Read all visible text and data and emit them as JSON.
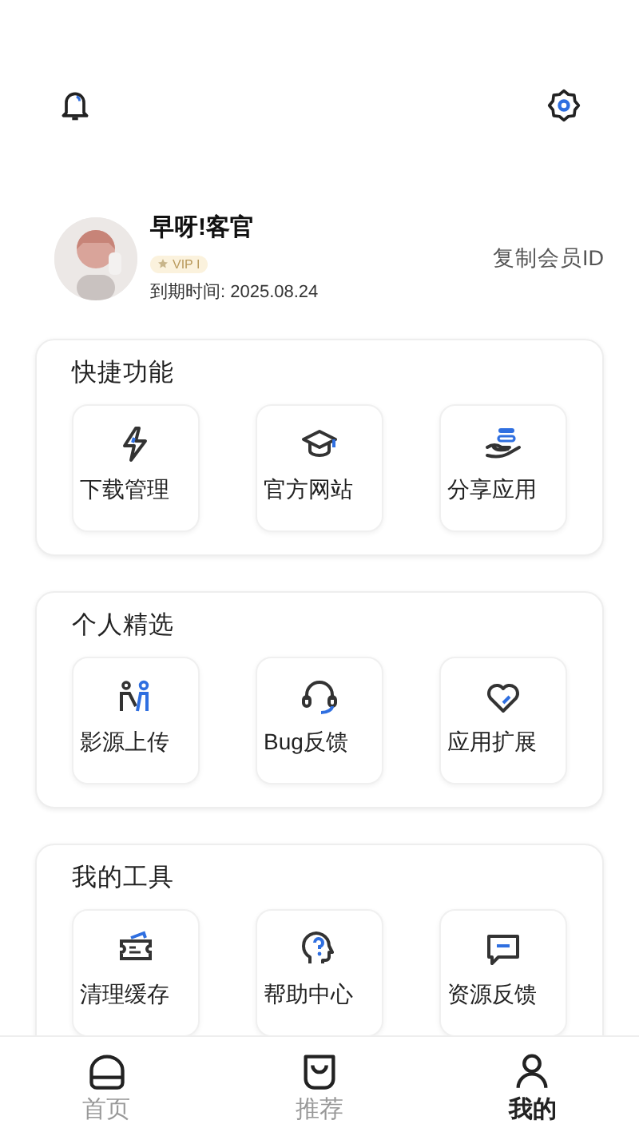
{
  "profile": {
    "name": "早呀!客官",
    "vip": "VIP I",
    "expiry": "到期时间: 2025.08.24",
    "copy_id": "复制会员ID"
  },
  "sections": [
    {
      "title": "快捷功能",
      "items": [
        {
          "label": "下载管理"
        },
        {
          "label": "官方网站"
        },
        {
          "label": "分享应用"
        }
      ]
    },
    {
      "title": "个人精选",
      "items": [
        {
          "label": "影源上传"
        },
        {
          "label": "Bug反馈"
        },
        {
          "label": "应用扩展"
        }
      ]
    },
    {
      "title": "我的工具",
      "items": [
        {
          "label": "清理缓存"
        },
        {
          "label": "帮助中心"
        },
        {
          "label": "资源反馈"
        }
      ]
    }
  ],
  "tabs": [
    {
      "label": "首页",
      "selected": false
    },
    {
      "label": "推荐",
      "selected": false
    },
    {
      "label": "我的",
      "selected": true
    }
  ]
}
